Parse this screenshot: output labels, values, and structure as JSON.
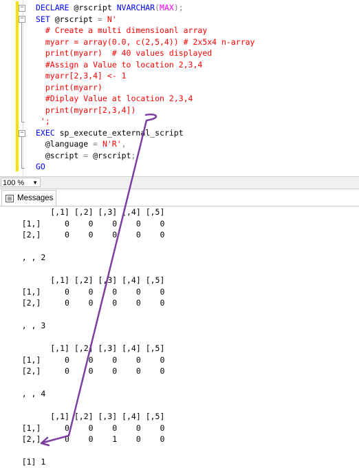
{
  "editor": {
    "lines": [
      [
        [
          "kw",
          "DECLARE "
        ],
        [
          "txt",
          "@rscript "
        ],
        [
          "kw",
          "NVARCHAR"
        ],
        [
          "gry",
          "("
        ],
        [
          "fn",
          "MAX"
        ],
        [
          "gry",
          ");"
        ]
      ],
      [
        [
          "kw",
          "SET "
        ],
        [
          "txt",
          "@rscript "
        ],
        [
          "gry",
          "= "
        ],
        [
          "str",
          "N'"
        ]
      ],
      [
        [
          "str",
          "  # Create a multi dimensioanl array"
        ]
      ],
      [
        [
          "str",
          "  myarr = array(0.0, c(2,5,4)) # 2x5x4 n-array"
        ]
      ],
      [
        [
          "str",
          "  print(myarr)  # 40 values displayed"
        ]
      ],
      [
        [
          "str",
          "  #Assign a Value to location 2,3,4"
        ]
      ],
      [
        [
          "str",
          "  myarr[2,3,4] <- 1"
        ]
      ],
      [
        [
          "str",
          "  print(myarr)"
        ]
      ],
      [
        [
          "str",
          "  #Diplay Value at location 2,3,4"
        ]
      ],
      [
        [
          "str",
          "  print(myarr[2,3,4])"
        ]
      ],
      [
        [
          "str",
          " ';"
        ]
      ],
      [
        [
          "kw",
          "EXEC "
        ],
        [
          "txt",
          "sp_execute_external_script"
        ]
      ],
      [
        [
          "txt",
          "  @language "
        ],
        [
          "gry",
          "= "
        ],
        [
          "str",
          "N'R'"
        ],
        [
          "gry",
          ","
        ]
      ],
      [
        [
          "txt",
          "  @script "
        ],
        [
          "gry",
          "= "
        ],
        [
          "txt",
          "@rscript"
        ],
        [
          "gry",
          ";"
        ]
      ],
      [
        [
          "kw",
          "GO"
        ]
      ]
    ]
  },
  "statusbar": {
    "zoom": "100 %"
  },
  "results_tab": {
    "label": "Messages"
  },
  "output": {
    "lines": [
      "          [,1] [,2] [,3] [,4] [,5]",
      "    [1,]     0    0    0    0    0",
      "    [2,]     0    0    0    0    0",
      "",
      "    , , 2",
      "",
      "          [,1] [,2] [,3] [,4] [,5]",
      "    [1,]     0    0    0    0    0",
      "    [2,]     0    0    0    0    0",
      "",
      "    , , 3",
      "",
      "          [,1] [,2] [,3] [,4] [,5]",
      "    [1,]     0    0    0    0    0",
      "    [2,]     0    0    0    0    0",
      "",
      "    , , 4",
      "",
      "          [,1] [,2] [,3] [,4] [,5]",
      "    [1,]     0    0    0    0    0",
      "    [2,]     0    0    1    0    0",
      "",
      "    [1] 1"
    ]
  },
  "annotation": {
    "color": "#7b3fa0"
  },
  "colors": {
    "keyword": "#0000ff",
    "string": "#ff0000",
    "function": "#ff00ff",
    "punct": "#808080"
  }
}
